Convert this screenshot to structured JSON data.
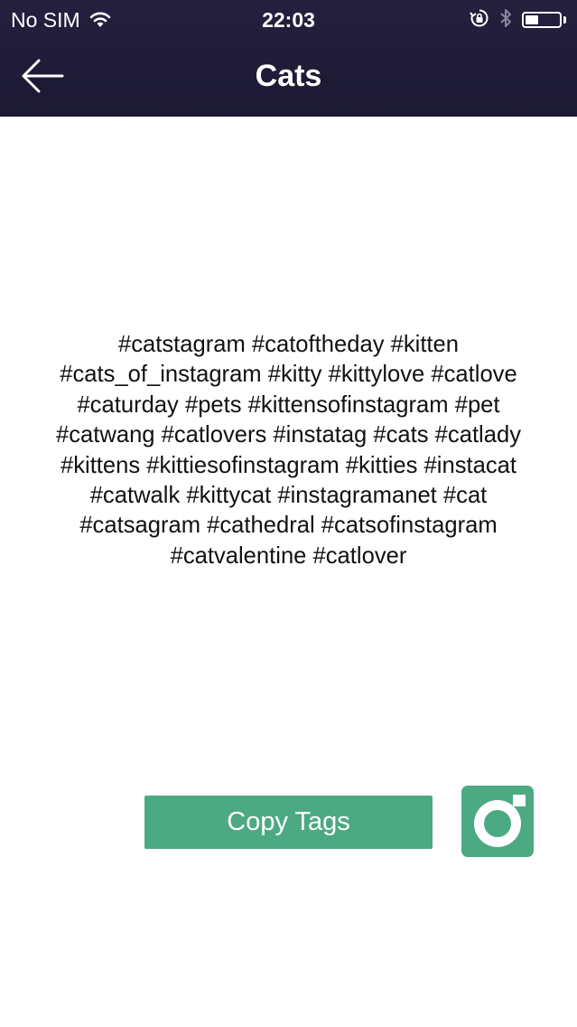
{
  "status_bar": {
    "carrier": "No SIM",
    "time": "22:03"
  },
  "nav": {
    "title": "Cats"
  },
  "tags_text": "#catstagram #catoftheday #kitten\n#cats_of_instagram #kitty #kittylove #catlove\n#caturday #pets #kittensofinstagram #pet\n#catwang #catlovers #instatag #cats #catlady\n#kittens #kittiesofinstagram #kitties #instacat\n#catwalk #kittycat #instagramanet #cat\n#catsagram #cathedral #catsofinstagram\n#catvalentine #catlover",
  "actions": {
    "copy_label": "Copy Tags"
  },
  "colors": {
    "nav_background": "#211d3a",
    "accent_green": "#4caa82",
    "text": "#111111"
  },
  "battery_level": 0.4,
  "icons": {
    "wifi": "wifi-icon",
    "orientation_lock": "orientation-lock-icon",
    "bluetooth": "bluetooth-icon",
    "battery": "battery-icon",
    "back": "back-arrow-icon",
    "instagram": "instagram-icon"
  }
}
